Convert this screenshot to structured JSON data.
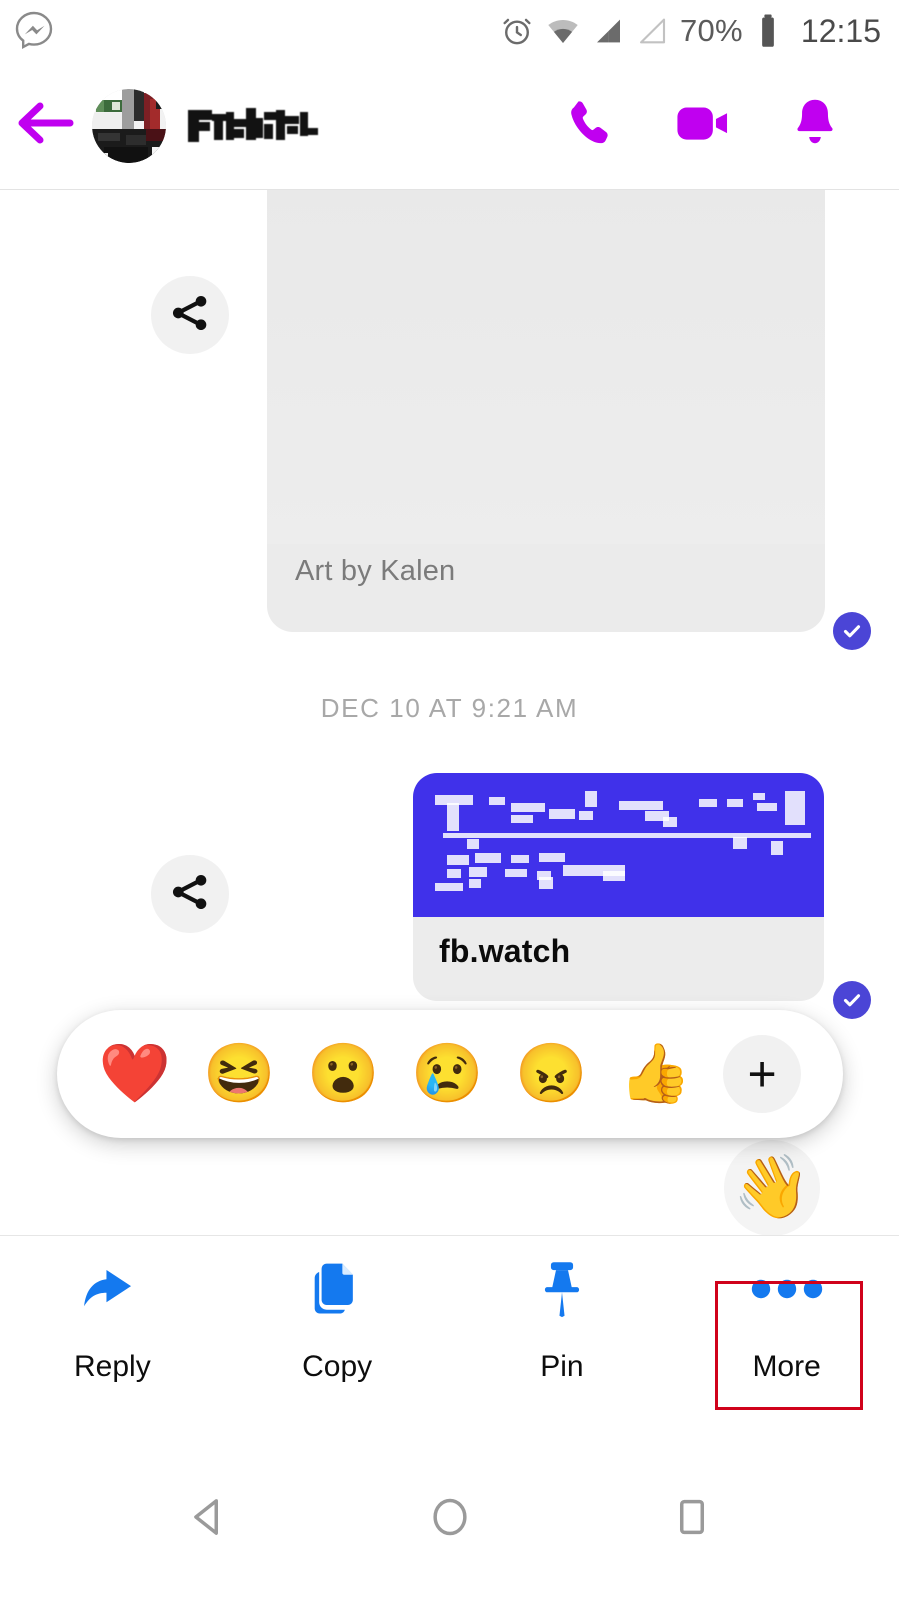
{
  "status_bar": {
    "app_logo": "messenger-logo",
    "icons": [
      "alarm-icon",
      "wifi-icon",
      "signal-sim1-icon",
      "signal-sim2-icon"
    ],
    "battery_percent": "70%",
    "battery_icon": "battery-icon",
    "clock": "12:15"
  },
  "nav_header": {
    "back_icon": "back-arrow-icon",
    "avatar": "contact-avatar-redacted",
    "contact_name": "",
    "contact_name_state": "pixelated-redacted",
    "actions": [
      {
        "name": "audio-call-button",
        "icon": "phone-icon"
      },
      {
        "name": "video-call-button",
        "icon": "video-camera-icon"
      },
      {
        "name": "notifications-button",
        "icon": "bell-icon"
      }
    ],
    "accent_color": "#c000f0"
  },
  "thread": {
    "messages": [
      {
        "type": "photo",
        "share_icon": "share-icon",
        "caption": "Art by Kalen",
        "status_icon": "delivered-check-icon"
      },
      {
        "type": "link",
        "share_icon": "share-icon",
        "hero_state": "pixelated-redacted",
        "domain": "fb.watch",
        "status_icon": "delivered-check-icon",
        "hero_color": "#4031ea"
      }
    ],
    "day_divider": "DEC 10 AT 9:21 AM",
    "floating_emoji": "👋"
  },
  "reaction_bar": {
    "reactions": [
      {
        "name": "reaction-love",
        "glyph": "❤️"
      },
      {
        "name": "reaction-haha",
        "glyph": "😆"
      },
      {
        "name": "reaction-wow",
        "glyph": "😮"
      },
      {
        "name": "reaction-sad",
        "glyph": "😢"
      },
      {
        "name": "reaction-angry",
        "glyph": "😠"
      },
      {
        "name": "reaction-like",
        "glyph": "👍"
      }
    ],
    "more_label": "+"
  },
  "action_sheet": {
    "actions": [
      {
        "name": "reply-action",
        "label": "Reply",
        "icon": "reply-arrow-icon"
      },
      {
        "name": "copy-action",
        "label": "Copy",
        "icon": "copy-icon"
      },
      {
        "name": "pin-action",
        "label": "Pin",
        "icon": "pin-icon"
      },
      {
        "name": "more-action",
        "label": "More",
        "icon": "ellipsis-icon"
      }
    ],
    "icon_color": "#1479ef",
    "highlight_color": "#d0021b",
    "highlighted_action": "More"
  },
  "android_nav": {
    "buttons": [
      {
        "name": "android-back-button",
        "icon": "triangle-back-icon"
      },
      {
        "name": "android-home-button",
        "icon": "circle-home-icon"
      },
      {
        "name": "android-recents-button",
        "icon": "square-recents-icon"
      }
    ]
  }
}
